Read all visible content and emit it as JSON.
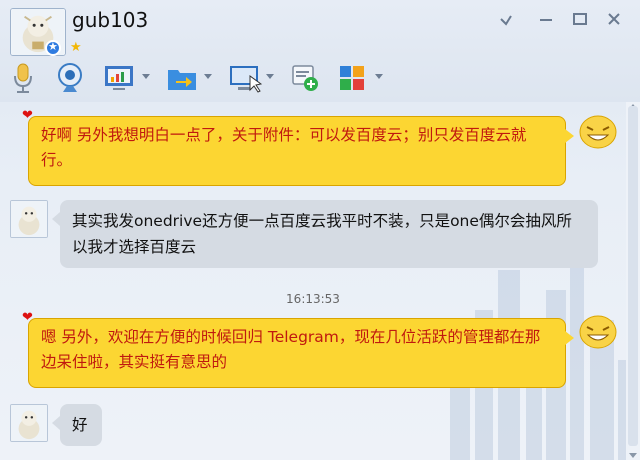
{
  "window": {
    "contact_name": "gub103",
    "level_icon": "star-icon",
    "controls": [
      "minimize-icon",
      "maximize-icon",
      "close-icon"
    ]
  },
  "toolbar": {
    "tools": [
      {
        "name": "voice-call",
        "icon": "microphone-icon",
        "has_menu": false
      },
      {
        "name": "video-call",
        "icon": "webcam-icon",
        "has_menu": false
      },
      {
        "name": "remote-assist",
        "icon": "presentation-chart-icon",
        "has_menu": true
      },
      {
        "name": "file-transfer",
        "icon": "folder-arrow-icon",
        "has_menu": true
      },
      {
        "name": "screen-share",
        "icon": "monitor-cursor-icon",
        "has_menu": true
      },
      {
        "name": "add-group-chat",
        "icon": "chat-add-icon",
        "has_menu": false
      },
      {
        "name": "apps",
        "icon": "apps-grid-icon",
        "has_menu": true
      }
    ]
  },
  "messages": [
    {
      "sender": "me",
      "text": "好啊 另外我想明白一点了，关于附件：可以发百度云；别只发百度云就行。"
    },
    {
      "sender": "other",
      "text": "其实我发onedrive还方便一点百度云我平时不装，只是one偶尔会抽风所以我才选择百度云"
    },
    {
      "timestamp": "16:13:53"
    },
    {
      "sender": "me",
      "text": "嗯 另外，欢迎在方便的时候回归 Telegram，现在几位活跃的管理都在那边呆住啦，其实挺有意思的"
    },
    {
      "sender": "other",
      "text": "好"
    }
  ],
  "colors": {
    "my_bubble": "#fcd632",
    "my_text": "#c0190f",
    "other_bubble": "#d5dbe3",
    "other_text": "#111111"
  }
}
